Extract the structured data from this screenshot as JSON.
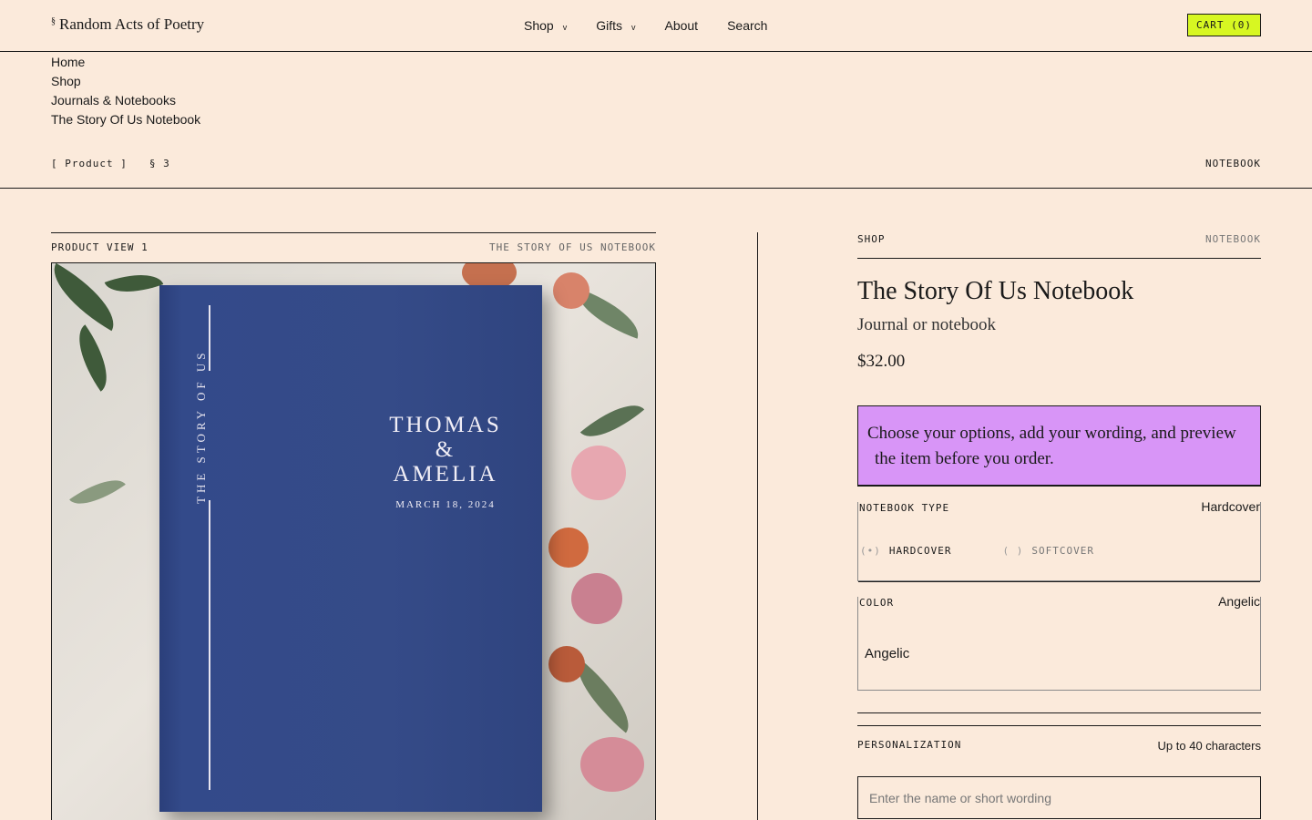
{
  "header": {
    "logo_mark": "§",
    "logo_text": "Random Acts of Poetry",
    "nav": [
      {
        "label": "Shop",
        "has_menu": true
      },
      {
        "label": "Gifts",
        "has_menu": true
      },
      {
        "label": "About",
        "has_menu": false
      },
      {
        "label": "Search",
        "has_menu": false
      }
    ],
    "chevron": "v",
    "cart_label": "CART (0)",
    "accent_color": "#d7f722"
  },
  "breadcrumbs": [
    "Home",
    "Shop",
    "Journals & Notebooks",
    "The Story Of Us Notebook"
  ],
  "meta": {
    "section_tag": "[ Product ]",
    "section_number": "§ 3",
    "category": "NOTEBOOK"
  },
  "product_view": {
    "label": "PRODUCT VIEW 1",
    "name_caption": "THE STORY OF US NOTEBOOK",
    "cover": {
      "spine_text": "THE STORY OF US",
      "name1": "THOMAS",
      "amp": "&",
      "name2": "AMELIA",
      "date": "MARCH 18, 2024",
      "cover_color": "#354b88"
    }
  },
  "panel": {
    "shop_label": "SHOP",
    "shop_category": "NOTEBOOK",
    "title": "The Story Of Us Notebook",
    "subtitle": "Journal or notebook",
    "price": "$32.00",
    "callout_line1": "Choose your options, add your wording, and preview",
    "callout_line2": "the item before you order.",
    "callout_color": "#d895f7",
    "notebook_type": {
      "label": "NOTEBOOK TYPE",
      "selected": "Hardcover",
      "options": [
        {
          "mark": "(•)",
          "label": "HARDCOVER"
        },
        {
          "mark": "( )",
          "label": "SOFTCOVER"
        }
      ]
    },
    "color": {
      "label": "COLOR",
      "selected": "Angelic",
      "value": "Angelic"
    },
    "personalization": {
      "label": "PERSONALIZATION",
      "hint": "Up to 40 characters",
      "placeholder": "Enter the name or short wording",
      "value": ""
    }
  }
}
